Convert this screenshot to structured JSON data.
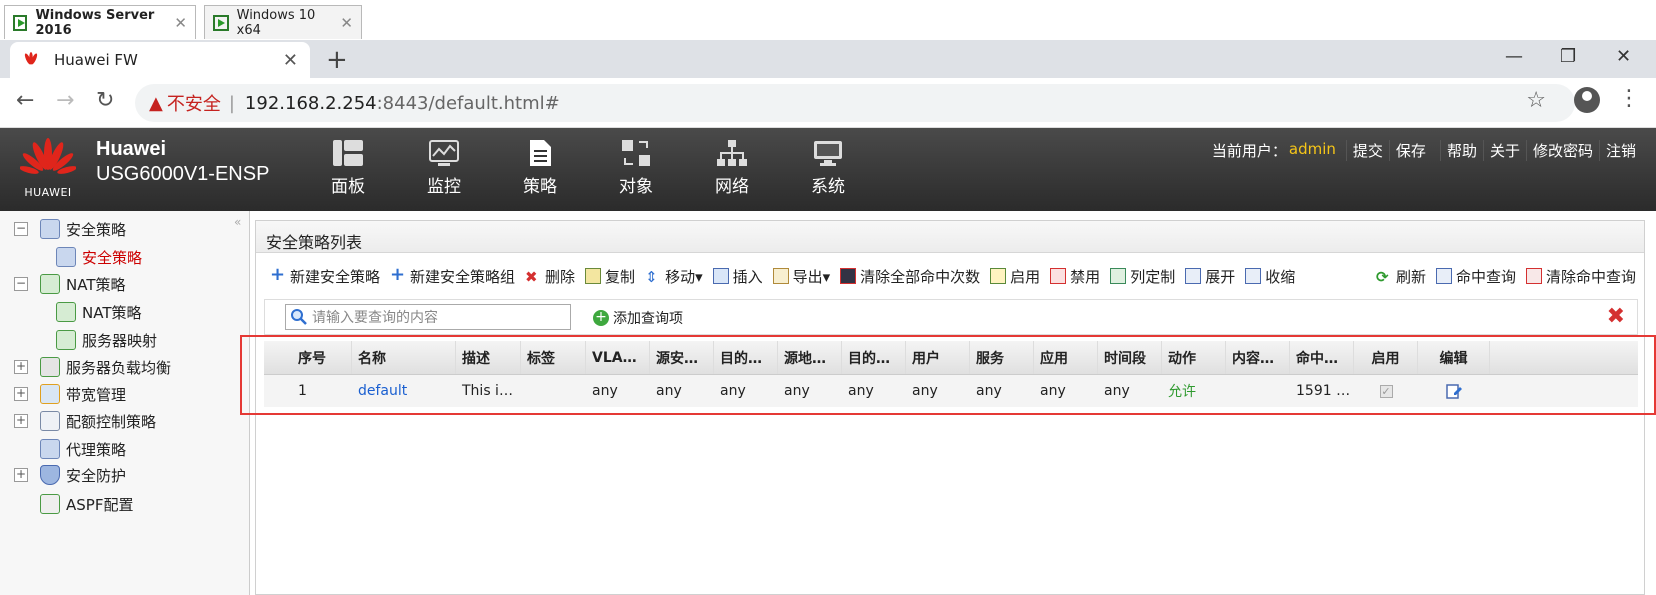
{
  "vm_tabs": [
    {
      "label": "Windows Server 2016",
      "active": true
    },
    {
      "label": "Windows 10 x64",
      "active": false
    }
  ],
  "browser": {
    "tab_title": "Huawei FW",
    "security_label": "不安全",
    "url_host": "192.168.2.254",
    "url_rest": ":8443/default.html#"
  },
  "header": {
    "logo_text": "HUAWEI",
    "brand_line1": "Huawei",
    "brand_line2": "USG6000V1-ENSP",
    "nav": [
      "面板",
      "监控",
      "策略",
      "对象",
      "网络",
      "系统"
    ],
    "current_user_label": "当前用户：",
    "user": "admin",
    "links": [
      "提交",
      "保存",
      "帮助",
      "关于",
      "修改密码",
      "注销"
    ]
  },
  "sidebar": {
    "items": [
      {
        "label": "安全策略",
        "level": 0,
        "toggle": "−"
      },
      {
        "label": "安全策略",
        "level": 1,
        "selected": true
      },
      {
        "label": "NAT策略",
        "level": 0,
        "toggle": "−"
      },
      {
        "label": "NAT策略",
        "level": 1
      },
      {
        "label": "服务器映射",
        "level": 1
      },
      {
        "label": "服务器负载均衡",
        "level": 0,
        "toggle": "+"
      },
      {
        "label": "带宽管理",
        "level": 0,
        "toggle": "+"
      },
      {
        "label": "配额控制策略",
        "level": 0,
        "toggle": "+"
      },
      {
        "label": "代理策略",
        "level": 0
      },
      {
        "label": "安全防护",
        "level": 0,
        "toggle": "+"
      },
      {
        "label": "ASPF配置",
        "level": 0
      }
    ]
  },
  "main": {
    "title": "安全策略列表",
    "toolbar": [
      "新建安全策略",
      "新建安全策略组",
      "删除",
      "复制",
      "移动▾",
      "插入",
      "导出▾",
      "清除全部命中次数",
      "启用",
      "禁用",
      "列定制",
      "展开",
      "收缩"
    ],
    "toolbar_right": [
      "刷新",
      "命中查询",
      "清除命中查询"
    ],
    "search_placeholder": "请输入要查询的内容",
    "add_query": "添加查询项",
    "columns": [
      "序号",
      "名称",
      "描述",
      "标签",
      "VLA…",
      "源安…",
      "目的…",
      "源地…",
      "目的…",
      "用户",
      "服务",
      "应用",
      "时间段",
      "动作",
      "内容…",
      "命中…",
      "启用",
      "编辑"
    ],
    "rows": [
      {
        "idx": "1",
        "name": "default",
        "desc": "This i…",
        "tag": "",
        "vlan": "any",
        "src_zone": "any",
        "dst_zone": "any",
        "src_addr": "any",
        "dst_addr": "any",
        "user": "any",
        "service": "any",
        "app": "any",
        "time": "any",
        "action": "允许",
        "content": "",
        "hits": "1591 …",
        "enabled": true
      }
    ]
  },
  "colors": {
    "accent_red": "#e53935",
    "allow_green": "#2f9a2f",
    "link_blue": "#1a5fd0",
    "user_yellow": "#f5c518"
  }
}
